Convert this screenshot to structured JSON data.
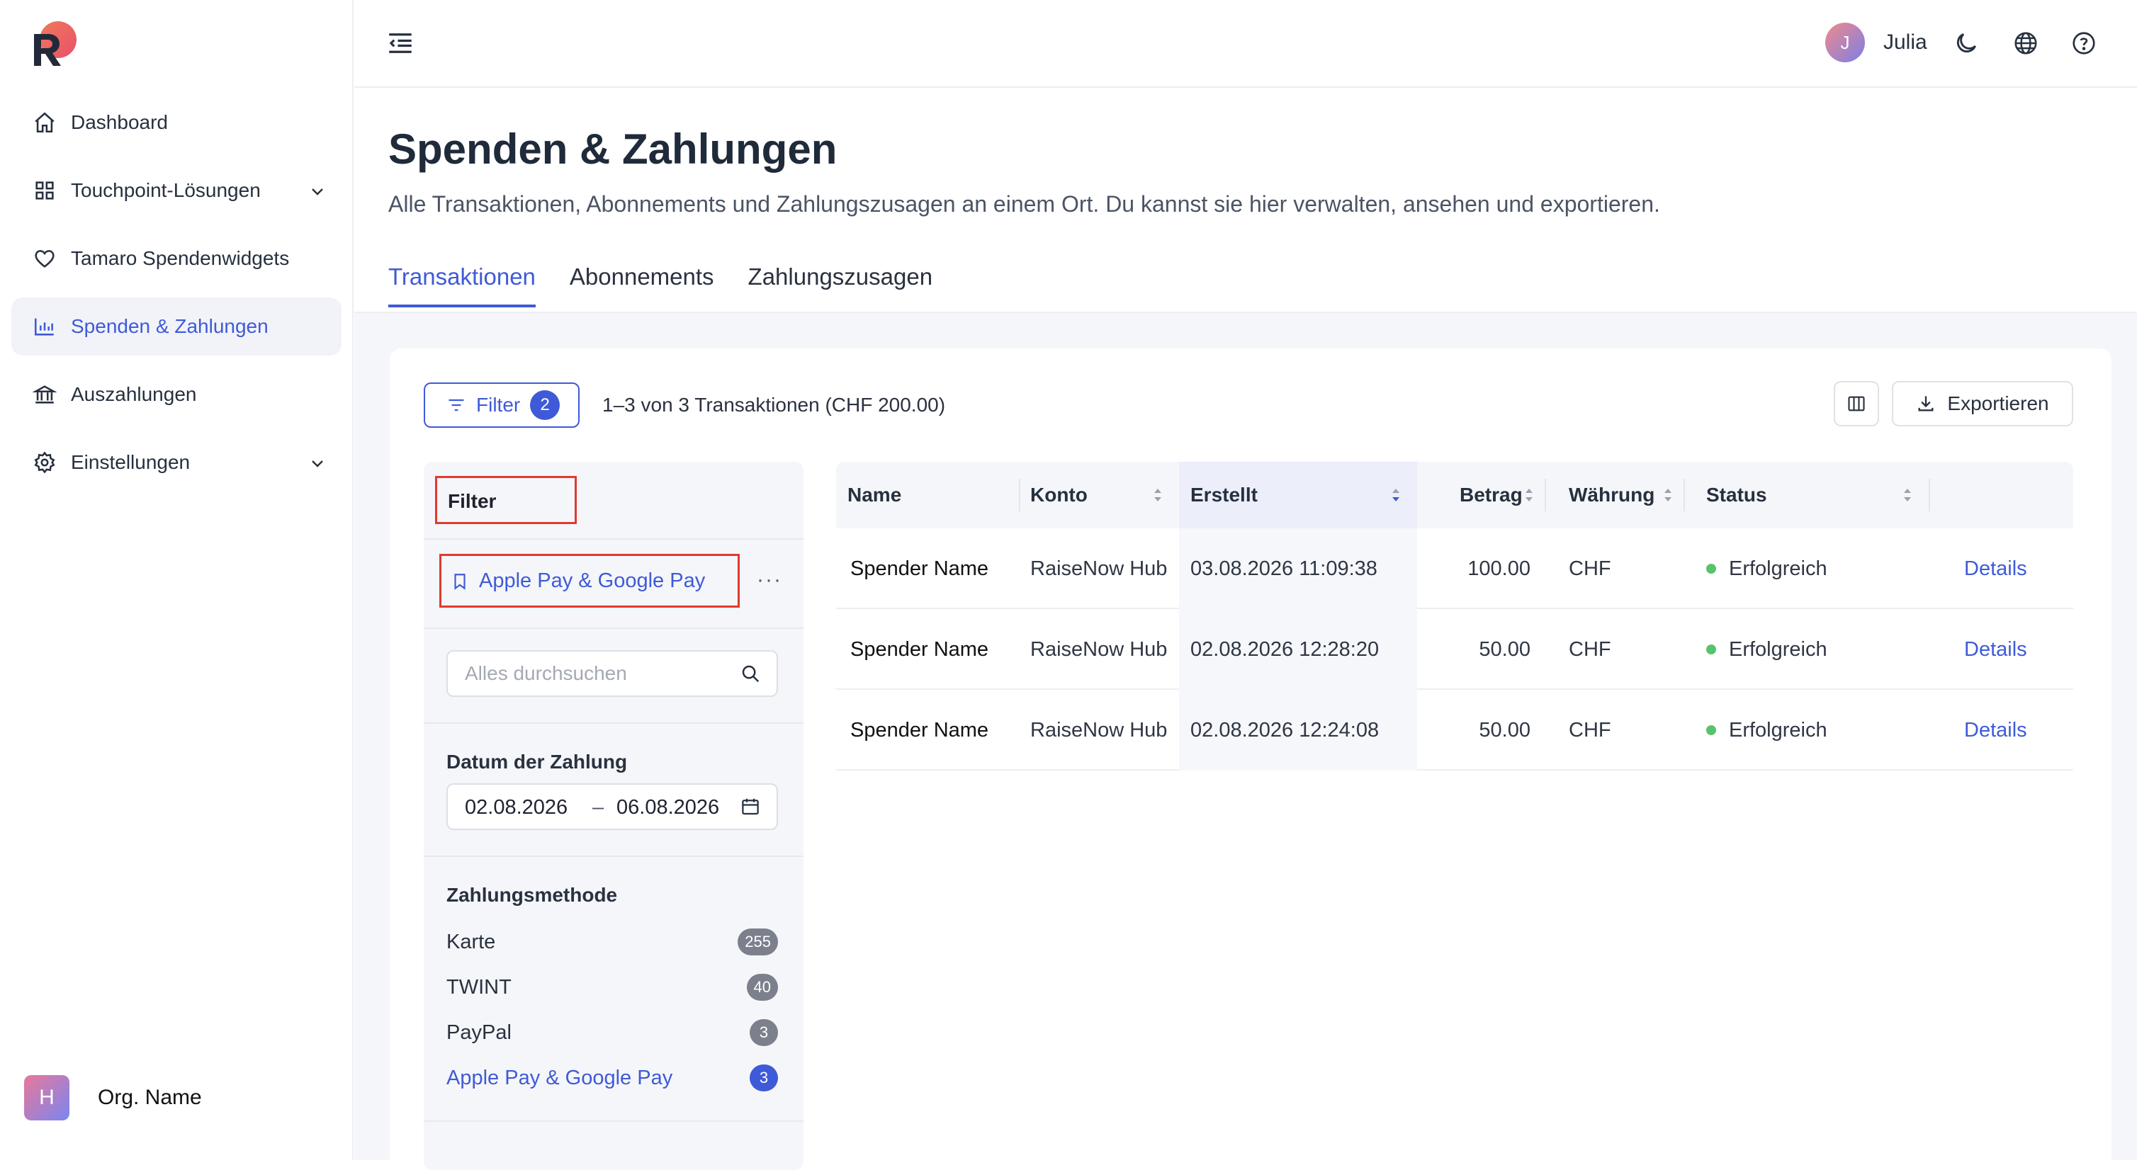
{
  "sidebar": {
    "items": [
      {
        "label": "Dashboard",
        "icon": "home-icon",
        "active": false
      },
      {
        "label": "Touchpoint-Lösungen",
        "icon": "grid-icon",
        "active": false,
        "expandable": true
      },
      {
        "label": "Tamaro Spendenwidgets",
        "icon": "heart-icon",
        "active": false
      },
      {
        "label": "Spenden & Zahlungen",
        "icon": "bar-chart-icon",
        "active": true
      },
      {
        "label": "Auszahlungen",
        "icon": "bank-icon",
        "active": false
      },
      {
        "label": "Einstellungen",
        "icon": "gear-icon",
        "active": false,
        "expandable": true
      }
    ],
    "org": {
      "initial": "H",
      "name": "Org. Name"
    }
  },
  "topbar": {
    "user": {
      "initial": "J",
      "name": "Julia"
    },
    "icons": [
      "moon-icon",
      "globe-icon",
      "help-icon"
    ]
  },
  "header": {
    "title": "Spenden & Zahlungen",
    "subtitle": "Alle Transaktionen, Abonnements und Zahlungszusagen an einem Ort. Du kannst sie hier verwalten, ansehen und exportieren.",
    "tabs": [
      {
        "label": "Transaktionen",
        "active": true
      },
      {
        "label": "Abonnements",
        "active": false
      },
      {
        "label": "Zahlungszusagen",
        "active": false
      }
    ]
  },
  "toolbar": {
    "filter_label": "Filter",
    "filter_count": "2",
    "summary": "1–3 von 3 Transaktionen (CHF 200.00)",
    "export_label": "Exportieren"
  },
  "filters": {
    "title": "Filter",
    "saved_filter": "Apple Pay & Google Pay",
    "more": "···",
    "search_placeholder": "Alles durchsuchen",
    "date_label": "Datum der Zahlung",
    "date_from": "02.08.2026",
    "date_sep": "–",
    "date_to": "06.08.2026",
    "payment_label": "Zahlungsmethode",
    "payment_methods": [
      {
        "label": "Karte",
        "count": "255",
        "selected": false
      },
      {
        "label": "TWINT",
        "count": "40",
        "selected": false
      },
      {
        "label": "PayPal",
        "count": "3",
        "selected": false
      },
      {
        "label": "Apple Pay & Google Pay",
        "count": "3",
        "selected": true
      }
    ]
  },
  "table": {
    "columns": [
      "Name",
      "Konto",
      "Erstellt",
      "Betrag",
      "Währung",
      "Status"
    ],
    "sorted_column": "Erstellt",
    "rows": [
      {
        "name": "Spender Name",
        "konto": "RaiseNow Hub",
        "erstellt": "03.08.2026 11:09:38",
        "betrag": "100.00",
        "waehrung": "CHF",
        "status": "Erfolgreich",
        "action": "Details"
      },
      {
        "name": "Spender Name",
        "konto": "RaiseNow Hub",
        "erstellt": "02.08.2026 12:28:20",
        "betrag": "50.00",
        "waehrung": "CHF",
        "status": "Erfolgreich",
        "action": "Details"
      },
      {
        "name": "Spender Name",
        "konto": "RaiseNow Hub",
        "erstellt": "02.08.2026 12:24:08",
        "betrag": "50.00",
        "waehrung": "CHF",
        "status": "Erfolgreich",
        "action": "Details"
      }
    ]
  },
  "colors": {
    "accent": "#3f5ad8",
    "highlight_box": "#e03a2f",
    "status_success": "#58c26d"
  }
}
